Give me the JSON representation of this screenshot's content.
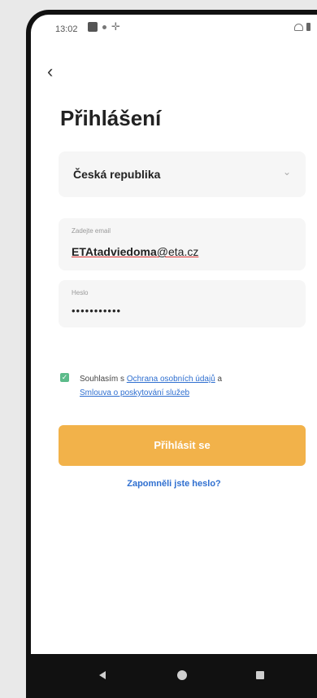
{
  "status_bar": {
    "time": "13:02"
  },
  "header": {
    "back_icon": "chevron-left-icon",
    "title": "Přihlášení"
  },
  "country": {
    "value": "Česká republika",
    "icon": "chevron-down-icon"
  },
  "email": {
    "label": "Zadejte email",
    "value_user": "ETAtadviedoma",
    "value_domain": "@eta.cz"
  },
  "password": {
    "label": "Heslo",
    "value": "•••••••••••"
  },
  "consent": {
    "prefix": "Souhlasím s ",
    "link1": "Ochrana osobních údajů",
    "middle": " a ",
    "link2": "Smlouva o poskytování služeb",
    "checked": true
  },
  "actions": {
    "login_label": "Přihlásit se",
    "forgot_label": "Zapomněli jste heslo?"
  },
  "colors": {
    "accent": "#f2b24a",
    "link": "#2f6fd0",
    "check": "#5cbb8a"
  }
}
